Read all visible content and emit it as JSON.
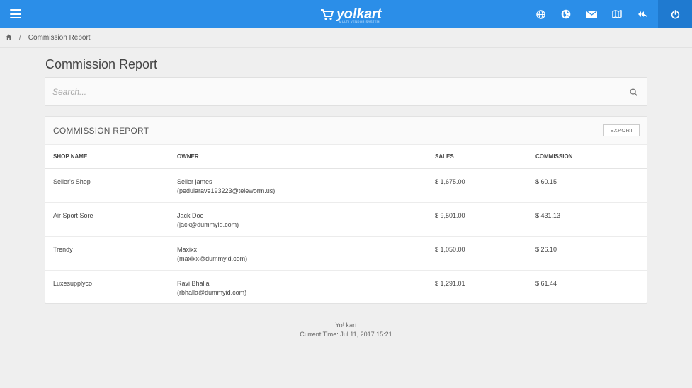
{
  "header": {
    "logo_text": "yo!kart",
    "logo_sub": "MULTI VENDOR SYSTEM",
    "icons": [
      "globe-icon",
      "world-icon",
      "mail-icon",
      "map-icon",
      "reply-all-icon",
      "power-icon"
    ],
    "accent": "#2b8ee8"
  },
  "breadcrumb": {
    "current": "Commission Report"
  },
  "page": {
    "title": "Commission Report"
  },
  "search": {
    "placeholder": "Search..."
  },
  "report": {
    "title": "COMMISSION REPORT",
    "export_label": "EXPORT",
    "columns": [
      "SHOP NAME",
      "OWNER",
      "SALES",
      "COMMISSION"
    ],
    "rows": [
      {
        "shop": "Seller's Shop",
        "owner_name": "Seller james",
        "owner_email": "(pedularave193223@teleworm.us)",
        "sales": "$ 1,675.00",
        "commission": "$ 60.15"
      },
      {
        "shop": "Air Sport Sore",
        "owner_name": "Jack Doe",
        "owner_email": "(jack@dummyid.com)",
        "sales": "$ 9,501.00",
        "commission": "$ 431.13"
      },
      {
        "shop": "Trendy",
        "owner_name": "Maxixx",
        "owner_email": "(maxixx@dummyid.com)",
        "sales": "$ 1,050.00",
        "commission": "$ 26.10"
      },
      {
        "shop": "Luxesupplyco",
        "owner_name": "Ravi Bhalla",
        "owner_email": "(rbhalla@dummyid.com)",
        "sales": "$ 1,291.01",
        "commission": "$ 61.44"
      }
    ]
  },
  "footer": {
    "brand": "Yo! kart",
    "time": "Current Time: Jul 11, 2017 15:21"
  }
}
